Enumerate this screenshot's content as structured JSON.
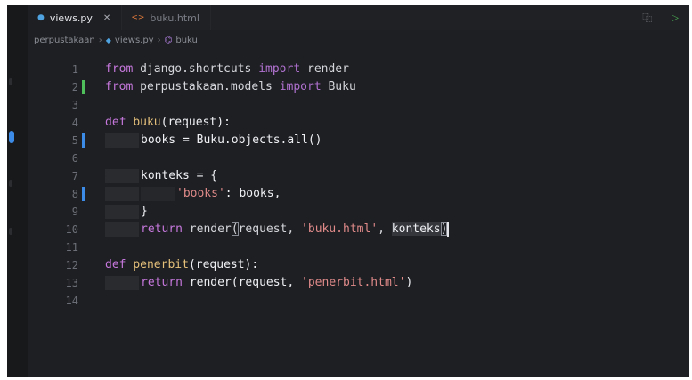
{
  "tabs": [
    {
      "label": "views.py",
      "type": "py",
      "active": true,
      "closable": true
    },
    {
      "label": "buku.html",
      "type": "html",
      "active": false,
      "closable": false
    }
  ],
  "breadcrumb": {
    "folder": "perpustakaan",
    "file": "views.py",
    "symbol": "buku"
  },
  "icons": {
    "py_file": "python-file-icon",
    "html_file": "html-file-icon",
    "close": "close-icon",
    "split": "split-editor-icon",
    "run": "run-icon",
    "function": "function-symbol-icon"
  },
  "colors": {
    "background": "#1e1f22",
    "keyword": "#c678dd",
    "function": "#e5c07b",
    "string": "#e08a8a",
    "modified_marker": "#3c8ce7",
    "added_marker": "#4fbf5b"
  },
  "lines": [
    {
      "n": "1",
      "t": [
        [
          "kw",
          "from "
        ],
        [
          "plain",
          "django.shortcuts "
        ],
        [
          "kw2",
          "import "
        ],
        [
          "plain",
          "render"
        ]
      ]
    },
    {
      "n": "2",
      "marker": "added",
      "t": [
        [
          "kw",
          "from "
        ],
        [
          "plain",
          "perpustakaan.models "
        ],
        [
          "kw2",
          "import "
        ],
        [
          "plain",
          "Buku"
        ]
      ]
    },
    {
      "n": "3",
      "t": []
    },
    {
      "n": "4",
      "t": [
        [
          "kw",
          "def "
        ],
        [
          "fn",
          "buku"
        ],
        [
          "bright",
          "(request):"
        ]
      ]
    },
    {
      "n": "5",
      "marker": "modified",
      "indent": 1,
      "t": [
        [
          "bright",
          "books = Buku.objects.all()"
        ]
      ]
    },
    {
      "n": "6",
      "t": []
    },
    {
      "n": "7",
      "indent": 1,
      "t": [
        [
          "bright",
          "konteks = {"
        ]
      ]
    },
    {
      "n": "8",
      "marker": "modified",
      "indent": 2,
      "t": [
        [
          "str",
          "'books'"
        ],
        [
          "bright",
          ": books,"
        ]
      ]
    },
    {
      "n": "9",
      "indent": 1,
      "t": [
        [
          "bright",
          "}"
        ]
      ]
    },
    {
      "n": "10",
      "indent": 1,
      "t": [
        [
          "kw",
          "return "
        ],
        [
          "plain",
          "render"
        ],
        [
          "match",
          "("
        ],
        [
          "plain",
          "request, "
        ],
        [
          "str",
          "'buku.html'"
        ],
        [
          "plain",
          ", "
        ],
        [
          "sel",
          "konteks"
        ],
        [
          "match",
          ")"
        ],
        [
          "cursor",
          ""
        ]
      ]
    },
    {
      "n": "11",
      "t": []
    },
    {
      "n": "12",
      "t": [
        [
          "kw",
          "def "
        ],
        [
          "fn",
          "penerbit"
        ],
        [
          "bright",
          "(request):"
        ]
      ]
    },
    {
      "n": "13",
      "indent": 1,
      "t": [
        [
          "kw",
          "return "
        ],
        [
          "bright",
          "render(request, "
        ],
        [
          "str",
          "'penerbit.html'"
        ],
        [
          "bright",
          ")"
        ]
      ]
    },
    {
      "n": "14",
      "t": []
    }
  ]
}
